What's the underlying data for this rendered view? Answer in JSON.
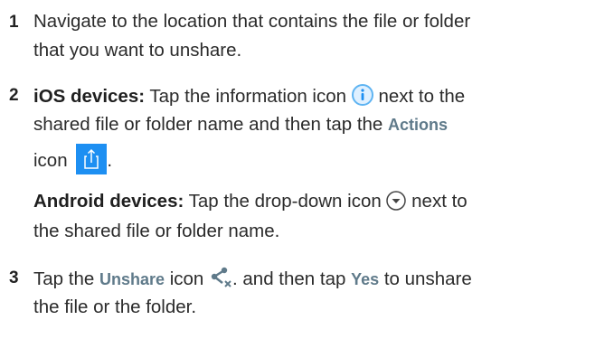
{
  "steps": [
    {
      "number": "1",
      "lines": [
        "Navigate to the location that contains the file or folder",
        "that you want to unshare."
      ]
    },
    {
      "number": "2",
      "ios_label": "iOS devices:",
      "ios_text_a": "Tap the information icon",
      "ios_text_b": "next to the",
      "ios_line2_a": "shared file or folder name and then tap the",
      "ios_actions_label": "Actions",
      "ios_line3_a": "icon",
      "ios_line3_b": ".",
      "android_label": "Android devices:",
      "android_text_a": "Tap the drop-down icon",
      "android_text_b": "next to",
      "android_line2": "the shared file or folder name."
    },
    {
      "number": "3",
      "text_a": "Tap the",
      "unshare_label": "Unshare",
      "text_b": "icon",
      "text_c": ". and then tap",
      "yes_label": "Yes",
      "text_d": "to unshare",
      "line2": "the file or the folder."
    }
  ],
  "icons": {
    "info": "info-icon",
    "actions": "share-actions-icon",
    "dropdown": "chevron-down-circle-icon",
    "unshare": "unshare-icon"
  },
  "colors": {
    "ui_term": "#5f7a8a",
    "actions_bg": "#1d8ff2",
    "info_stroke": "#5fb4f2"
  }
}
